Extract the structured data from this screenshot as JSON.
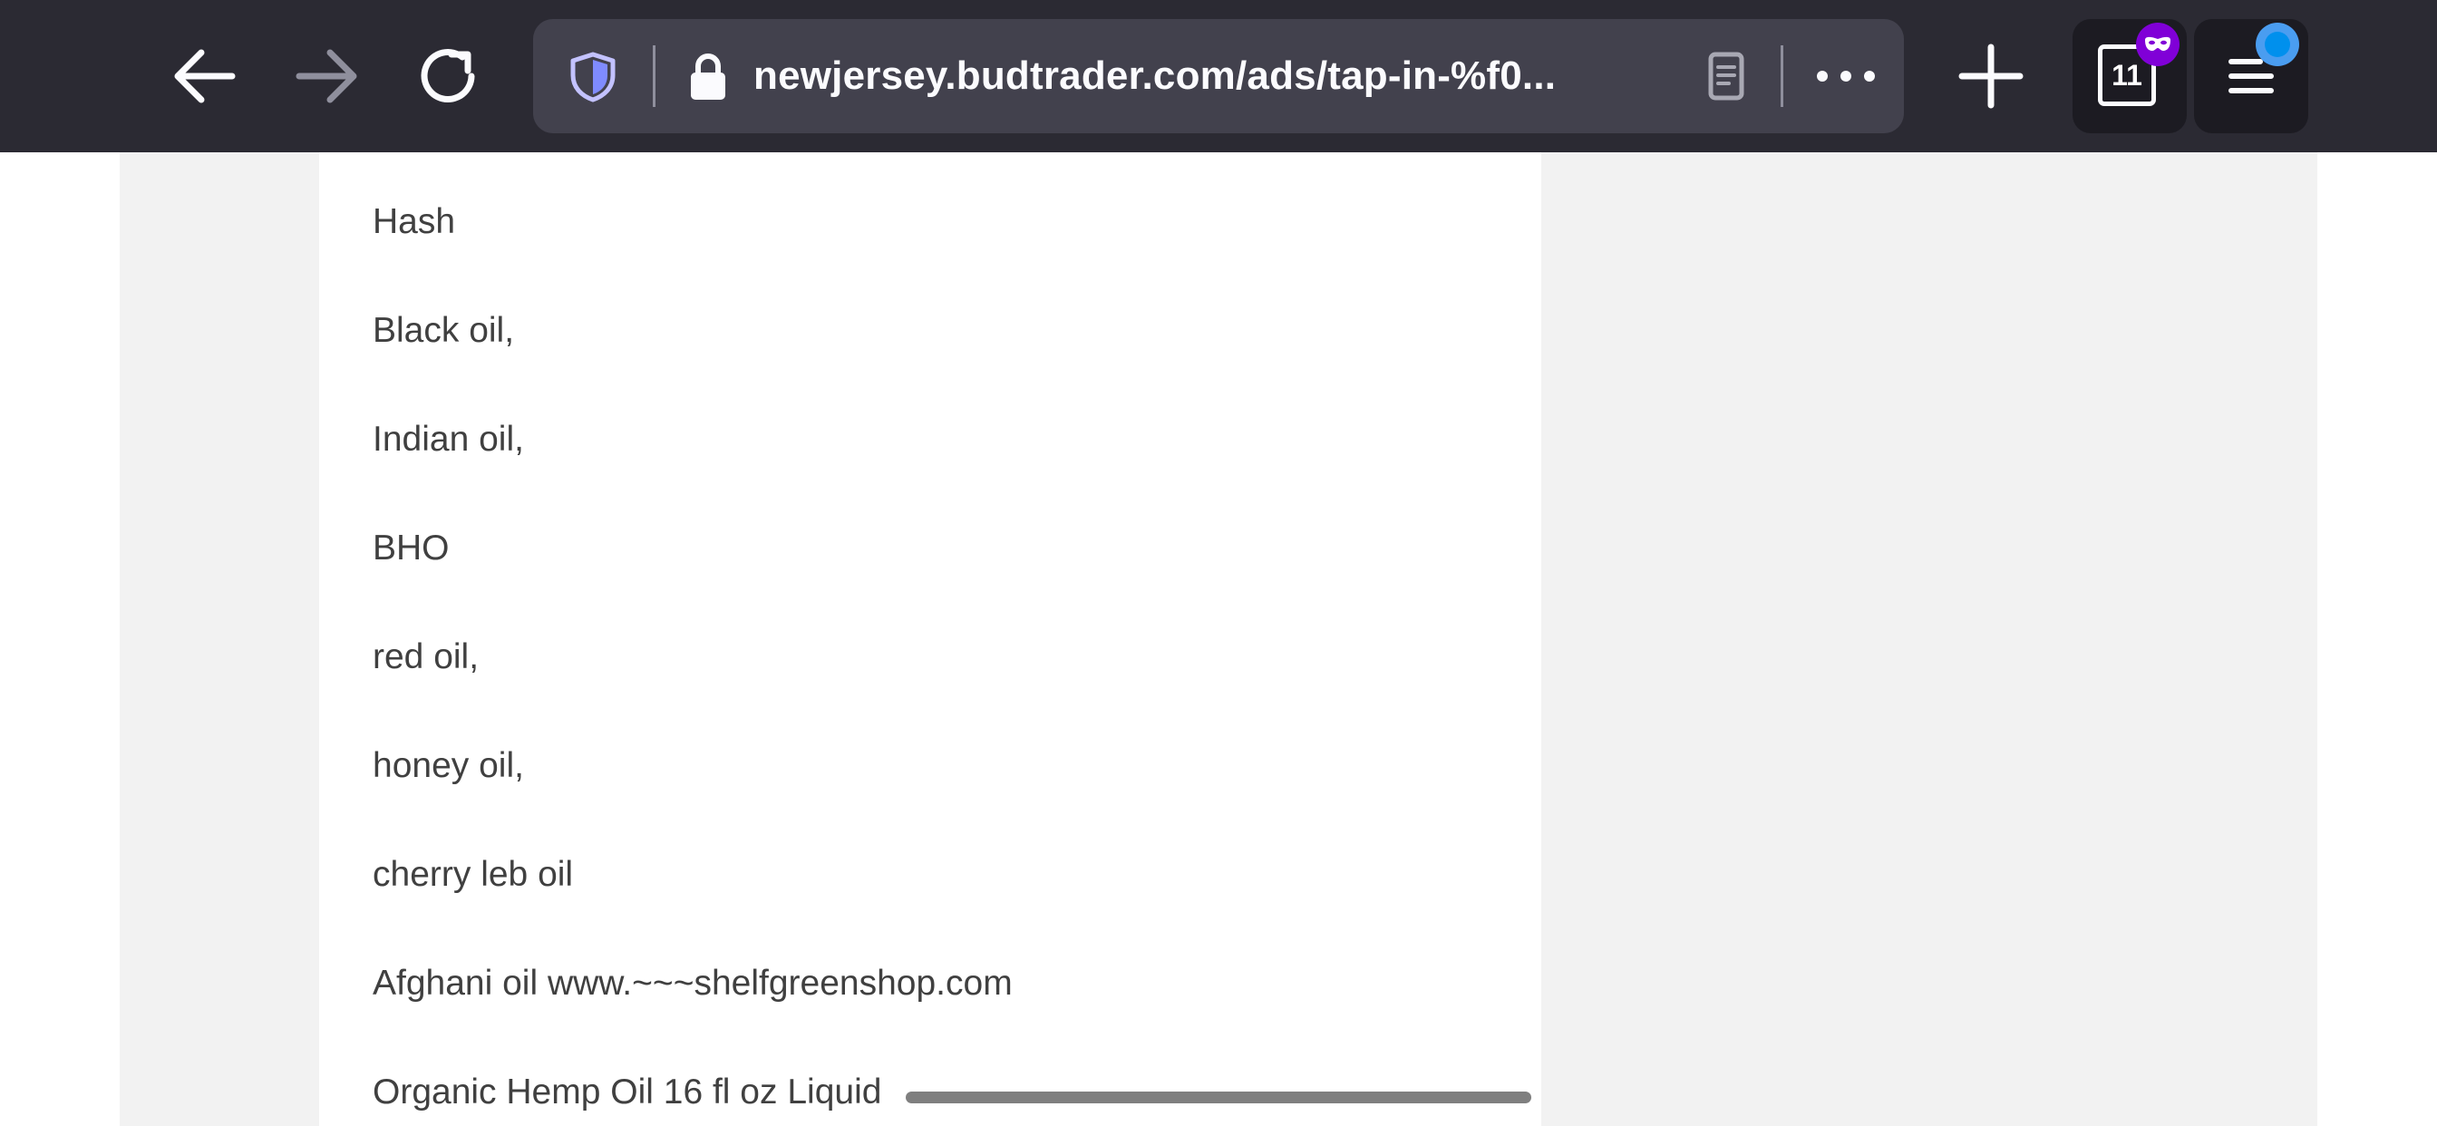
{
  "toolbar": {
    "back_icon": "back-arrow-icon",
    "forward_icon": "forward-arrow-icon",
    "reload_icon": "reload-icon",
    "url": "newjersey.budtrader.com/ads/tap-in-%f0...",
    "shield_icon": "tracking-protection-shield-icon",
    "lock_icon": "lock-icon",
    "reader_icon": "reader-view-icon",
    "more_icon": "more-options-icon",
    "new_tab_icon": "plus-icon",
    "tab_count": "11",
    "private_badge_icon": "private-mask-icon",
    "menu_icon": "hamburger-menu-icon",
    "colors": {
      "toolbar_bg": "#2b2a33",
      "urlbar_bg": "#42414d",
      "private_badge": "#8000d7",
      "notification_dot": "#0090ed"
    }
  },
  "page": {
    "lines": [
      "Hash",
      "Black oil,",
      "Indian oil,",
      "BHO",
      "red oil,",
      "honey oil,",
      "cherry leb oil",
      "Afghani oil www.~~~shelfgreenshop.com",
      "Organic Hemp Oil 16 fl oz Liquid"
    ]
  }
}
